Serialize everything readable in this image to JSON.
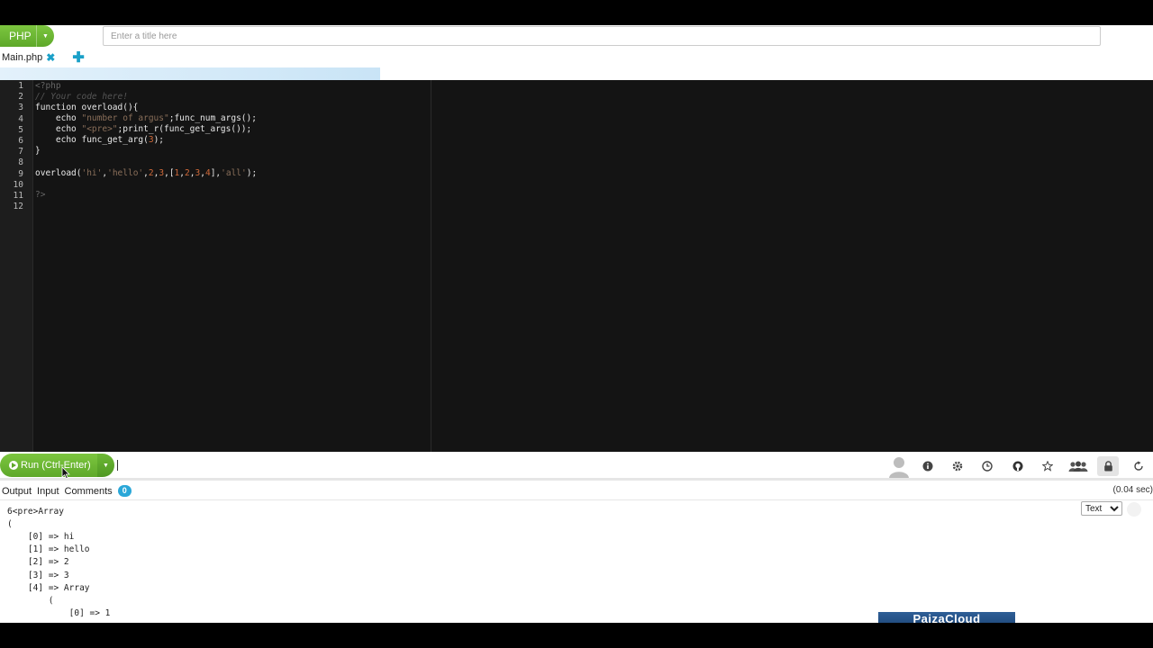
{
  "header": {
    "language": "PHP",
    "title_placeholder": "Enter a title here",
    "tab_name": "Main.php",
    "tab_close": "✖",
    "tab_add": "✚",
    "load_progress": 0.33
  },
  "editor": {
    "line_numbers": [
      "1",
      "2",
      "3",
      "4",
      "5",
      "6",
      "7",
      "8",
      "9",
      "10",
      "11",
      "12"
    ]
  },
  "runbar": {
    "run_label": "Run (Ctrl-Enter)",
    "icons": [
      "user-avatar-icon",
      "info-icon",
      "gear-icon",
      "clock-icon",
      "github-icon",
      "star-icon",
      "users-icon",
      "lock-icon",
      "share-icon"
    ]
  },
  "output": {
    "tabs": {
      "output": "Output",
      "input": "Input",
      "comments": "Comments",
      "comments_count": "0"
    },
    "elapsed": "(0.04 sec)",
    "lines": [
      "6<pre>Array",
      "(",
      "    [0] => hi",
      "    [1] => hello",
      "    [2] => 2",
      "    [3] => 3",
      "    [4] => Array",
      "        (",
      "            [0] => 1"
    ],
    "format": "Text"
  },
  "branding": {
    "logo_text": "PaizaCloud"
  },
  "colors": {
    "accent_green": "#6ab434",
    "accent_blue": "#2aa7d8",
    "editor_bg": "#141414"
  }
}
